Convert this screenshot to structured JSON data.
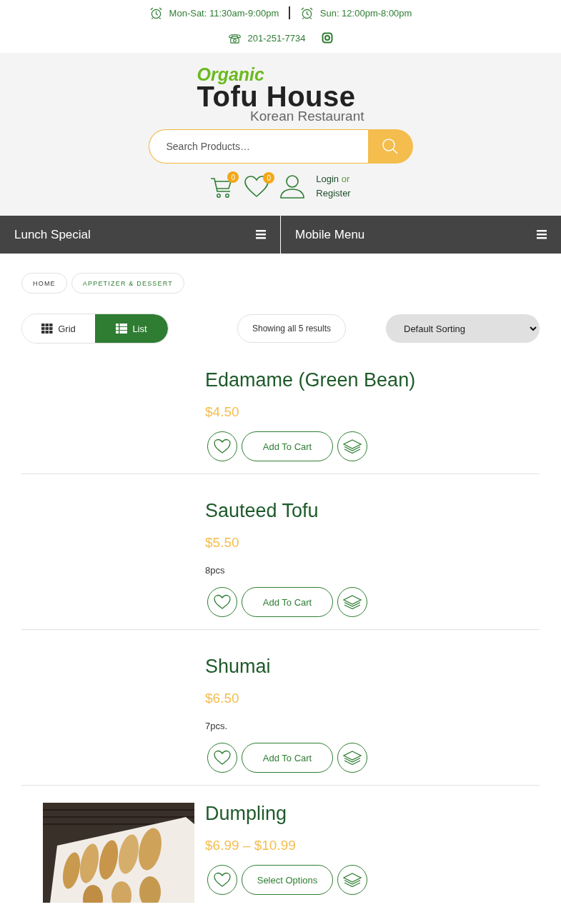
{
  "top_bar": {
    "hours": [
      "Mon-Sat: 11:30am-9:00pm",
      "Sun: 12:00pm-8:00pm"
    ],
    "phone": "201-251-7734"
  },
  "logo": {
    "line_1": "Organic",
    "line_2": "Tofu House",
    "line_3": "Korean Restaurant"
  },
  "search": {
    "placeholder": "Search Products…"
  },
  "header_actions": {
    "cart_count": "0",
    "wishlist_count": "0",
    "login": "Login",
    "or": "or",
    "register": "Register"
  },
  "nav": [
    "Lunch Special",
    "Mobile Menu"
  ],
  "breadcrumbs": [
    {
      "label": "HOME",
      "selected": false
    },
    {
      "label": "APPETIZER & DESSERT",
      "selected": true
    }
  ],
  "view_toggle": [
    {
      "label": "Grid",
      "kind": "grid",
      "selected": false
    },
    {
      "label": "List",
      "kind": "list",
      "selected": true
    }
  ],
  "result_count": "Showing all 5 results",
  "sorting": "Default Sorting",
  "products": [
    {
      "name": "Edamame (Green Bean)",
      "price": "$4.50",
      "button": "Add To Cart"
    },
    {
      "name": "Sauteed Tofu",
      "price": "$5.50",
      "description": "8pcs",
      "button": "Add To Cart"
    },
    {
      "name": "Shumai",
      "price": "$6.50",
      "description": "7pcs.",
      "button": "Add To Cart"
    },
    {
      "name": "Dumpling",
      "price": "$6.99 – $10.99",
      "button": "Select Options"
    }
  ]
}
